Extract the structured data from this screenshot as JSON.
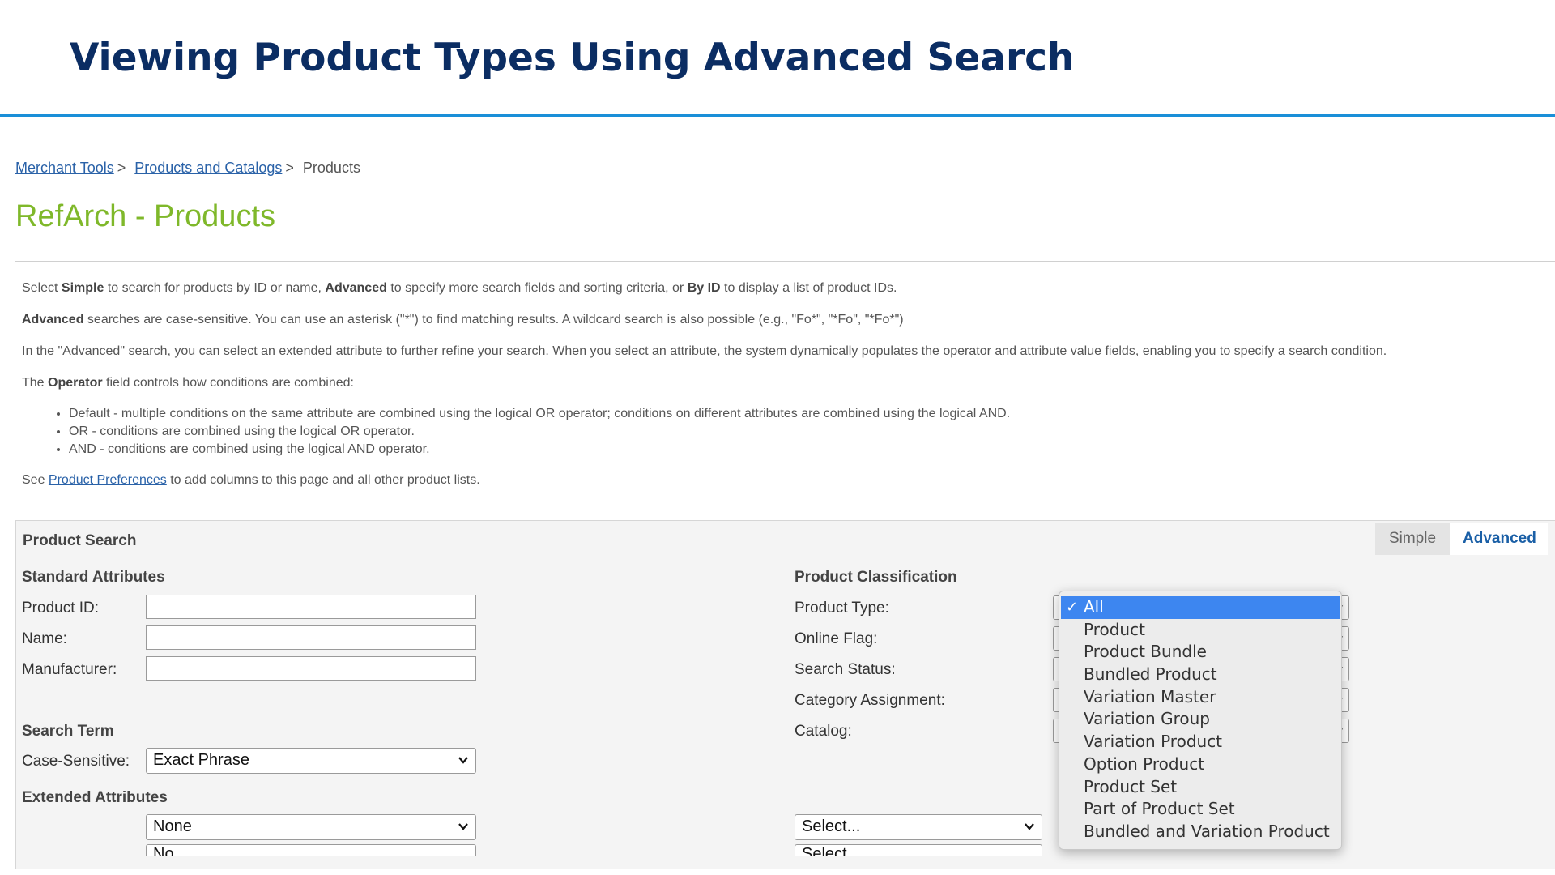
{
  "slide": {
    "title": "Viewing Product Types Using Advanced Search"
  },
  "breadcrumb": {
    "items": [
      {
        "label": "Merchant Tools",
        "link": true
      },
      {
        "label": "Products and Catalogs",
        "link": true
      },
      {
        "label": "Products",
        "link": false
      }
    ],
    "separator": ">"
  },
  "page": {
    "title": "RefArch - Products"
  },
  "help": {
    "p1": {
      "a": "Select ",
      "b1": "Simple",
      "c": " to search for products by ID or name, ",
      "b2": "Advanced",
      "d": " to specify more search fields and sorting criteria, or ",
      "b3": "By ID",
      "e": " to display a list of product IDs."
    },
    "p2": {
      "b": "Advanced",
      "rest": " searches are case-sensitive. You can use an asterisk (\"*\") to find matching results. A wildcard search is also possible (e.g., \"Fo*\", \"*Fo\", \"*Fo*\")"
    },
    "p3": "In the \"Advanced\" search, you can select an extended attribute to further refine your search. When you select an attribute, the system dynamically populates the operator and attribute value fields, enabling you to specify a search condition.",
    "p4": {
      "a": "The ",
      "b": "Operator",
      "c": " field controls how conditions are combined:"
    },
    "bullets": [
      "Default - multiple conditions on the same attribute are combined using the logical OR operator; conditions on different attributes are combined using the logical AND.",
      "OR - conditions are combined using the logical OR operator.",
      "AND - conditions are combined using the logical AND operator."
    ],
    "p5": {
      "a": "See ",
      "link": "Product Preferences",
      "b": " to add columns to this page and all other product lists."
    }
  },
  "search": {
    "title": "Product Search",
    "tabs": {
      "simple": "Simple",
      "advanced": "Advanced"
    },
    "standard": {
      "heading": "Standard Attributes",
      "product_id_label": "Product ID:",
      "name_label": "Name:",
      "manufacturer_label": "Manufacturer:"
    },
    "search_term": {
      "heading": "Search Term",
      "case_label": "Case-Sensitive:",
      "case_value": "Exact Phrase"
    },
    "extended": {
      "heading": "Extended Attributes",
      "attribute_value": "None",
      "attribute_value_2": "No",
      "operator_value": "Select...",
      "operator_value_2": "Select..."
    },
    "classification": {
      "heading": "Product Classification",
      "product_type_label": "Product Type:",
      "online_flag_label": "Online Flag:",
      "search_status_label": "Search Status:",
      "category_label": "Category Assignment:",
      "catalog_label": "Catalog:"
    },
    "product_type_dropdown": {
      "selected": "All",
      "options": [
        "All",
        "Product",
        "Product Bundle",
        "Bundled Product",
        "Variation Master",
        "Variation Group",
        "Variation Product",
        "Option Product",
        "Product Set",
        "Part of Product Set",
        "Bundled and Variation Product"
      ]
    }
  },
  "colors": {
    "slide_title": "#0b2d63",
    "title_rule": "#1a8fd8",
    "page_title": "#7fb82a",
    "link": "#2a62a8",
    "selected_option": "#3d86f0"
  }
}
